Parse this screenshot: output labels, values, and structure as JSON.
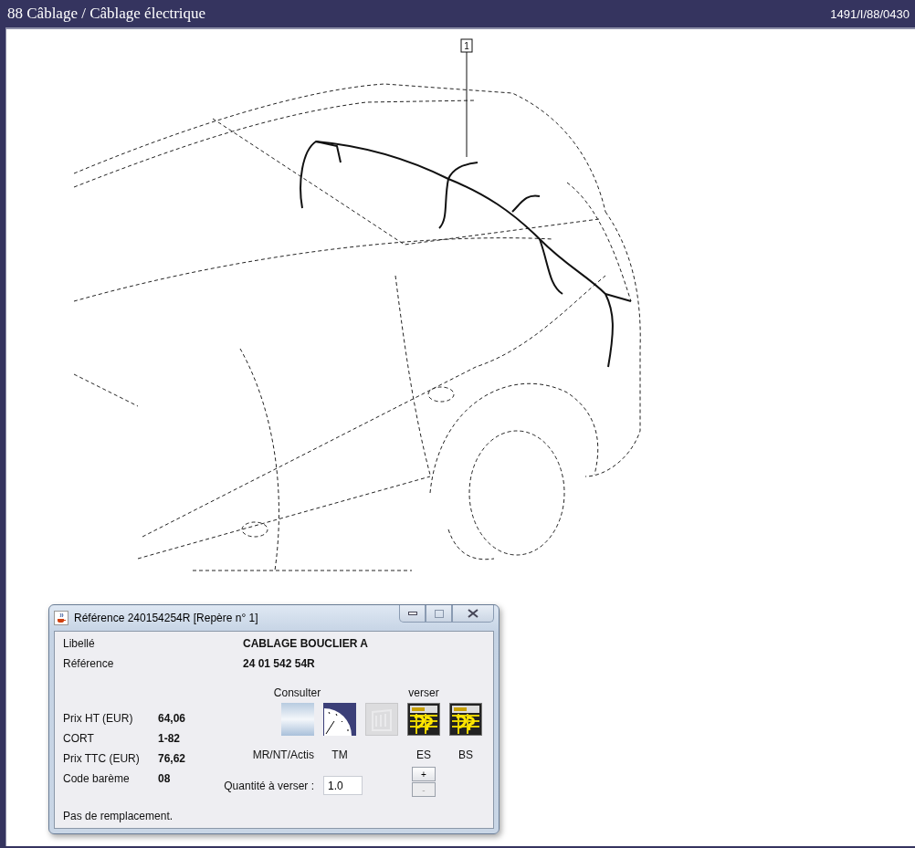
{
  "window": {
    "title": "88 Câblage / Câblage électrique",
    "code": "1491/I/88/0430"
  },
  "diagram": {
    "callout": "1"
  },
  "dialog": {
    "title": "Référence 240154254R [Repère n° 1]",
    "fields": [
      {
        "label": "Libellé",
        "value": "CABLAGE BOUCLIER A"
      },
      {
        "label": "Référence",
        "value": "24 01 542 54R"
      }
    ],
    "prices": [
      {
        "label": "Prix HT (EUR)",
        "value": "64,06"
      },
      {
        "label": "CORT",
        "value": "1-82"
      },
      {
        "label": "Prix TTC (EUR)",
        "value": "76,62"
      },
      {
        "label": "Code barème",
        "value": "08"
      }
    ],
    "groups": [
      "Consulter",
      "verser"
    ],
    "actions": [
      {
        "kind": "gradient",
        "label": "MR/NT/Actis",
        "disabled": false
      },
      {
        "kind": "gauge",
        "label": "TM",
        "disabled": false
      },
      {
        "kind": "cabinet",
        "disabled": true
      },
      {
        "kind": "sheet",
        "label": "ES",
        "disabled": false
      },
      {
        "kind": "sheet",
        "label": "BS",
        "disabled": false
      }
    ],
    "quantity": {
      "label": "Quantité à verser :",
      "value": "1.0"
    },
    "steppers": [
      {
        "label": "+",
        "disabled": false
      },
      {
        "label": "-",
        "disabled": true
      }
    ],
    "status": "Pas de remplacement."
  }
}
